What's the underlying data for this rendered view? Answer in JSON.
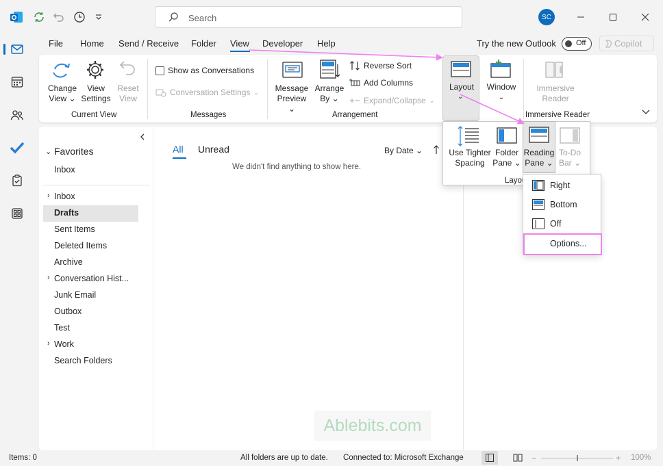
{
  "titlebar": {
    "search_placeholder": "Search",
    "avatar_initials": "SC"
  },
  "menu": {
    "tabs": [
      "File",
      "Home",
      "Send / Receive",
      "Folder",
      "View",
      "Developer",
      "Help"
    ],
    "active_tab": "View",
    "try_new_outlook": "Try the new Outlook",
    "toggle_label": "Off",
    "copilot": "Copilot"
  },
  "ribbon": {
    "current_view": {
      "change_view": "Change",
      "change_view_2": "View",
      "view_settings": "View",
      "view_settings_2": "Settings",
      "reset_view": "Reset",
      "reset_view_2": "View",
      "group": "Current View"
    },
    "messages": {
      "show_as_conversations": "Show as Conversations",
      "conversation_settings": "Conversation Settings",
      "group": "Messages"
    },
    "arrangement": {
      "message_preview": "Message",
      "message_preview_2": "Preview",
      "arrange_by": "Arrange",
      "arrange_by_2": "By",
      "reverse_sort": "Reverse Sort",
      "add_columns": "Add Columns",
      "expand_collapse": "Expand/Collapse",
      "group": "Arrangement"
    },
    "layout": {
      "label": "Layout"
    },
    "window": {
      "label": "Window"
    },
    "immersive": {
      "label": "Immersive",
      "label_2": "Reader",
      "group": "Immersive Reader"
    }
  },
  "layout_panel": {
    "tighter": "Use Tighter",
    "tighter_2": "Spacing",
    "folder_pane": "Folder",
    "folder_pane_2": "Pane",
    "reading_pane": "Reading",
    "reading_pane_2": "Pane",
    "todo": "To-Do",
    "todo_2": "Bar",
    "group": "Layout"
  },
  "reading_pane_menu": {
    "right": "Right",
    "bottom": "Bottom",
    "off": "Off",
    "options": "Options..."
  },
  "folders": {
    "favorites": "Favorites",
    "fav_inbox": "Inbox",
    "items": [
      "Inbox",
      "Drafts",
      "Sent Items",
      "Deleted Items",
      "Archive",
      "Conversation Hist...",
      "Junk Email",
      "Outbox",
      "Test",
      "Work",
      "Search Folders"
    ],
    "selected": "Drafts"
  },
  "message_list": {
    "tab_all": "All",
    "tab_unread": "Unread",
    "sort": "By Date",
    "empty": "We didn't find anything to show here."
  },
  "status": {
    "items": "Items: 0",
    "sync": "All folders are up to date.",
    "connection": "Connected to: Microsoft Exchange",
    "zoom": "100%"
  },
  "watermark": "Ablebits.com",
  "colors": {
    "accent": "#0f6cbd",
    "highlight_arrow": "#ee82ee",
    "todo_check": "#2b7cd3"
  }
}
